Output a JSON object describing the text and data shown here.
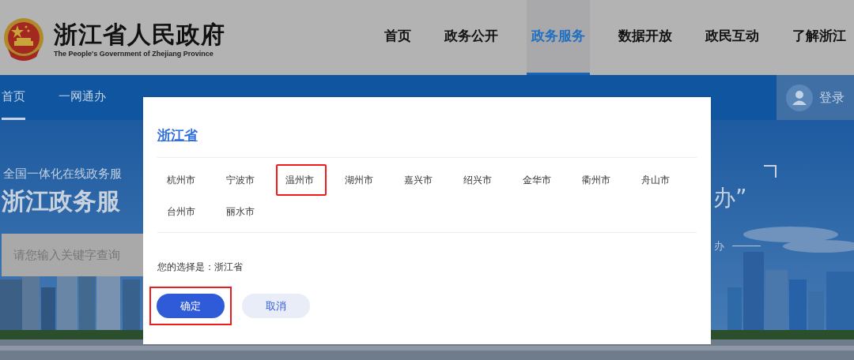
{
  "header": {
    "logo_title": "浙江省人民政府",
    "logo_subtitle": "The People's Government of Zhejiang Province",
    "nav": [
      {
        "label": "首页",
        "selected": false
      },
      {
        "label": "政务公开",
        "selected": false
      },
      {
        "label": "政务服务",
        "selected": true
      },
      {
        "label": "数据开放",
        "selected": false
      },
      {
        "label": "政民互动",
        "selected": false
      },
      {
        "label": "了解浙江",
        "selected": false
      }
    ]
  },
  "subnav": {
    "items": [
      {
        "label": "首页",
        "selected": true
      },
      {
        "label": "一网通办",
        "selected": false
      }
    ],
    "login": "登录"
  },
  "hero": {
    "kicker": "全国一体化在线政务服",
    "title": "浙江政务服",
    "slogan": "办”",
    "slogan_sub": "办",
    "search": {
      "placeholder": "请您输入关键字查询"
    }
  },
  "dialog": {
    "province": "浙江省",
    "cities": [
      {
        "name": "杭州市",
        "highlighted": false
      },
      {
        "name": "宁波市",
        "highlighted": false
      },
      {
        "name": "温州市",
        "highlighted": true
      },
      {
        "name": "湖州市",
        "highlighted": false
      },
      {
        "name": "嘉兴市",
        "highlighted": false
      },
      {
        "name": "绍兴市",
        "highlighted": false
      },
      {
        "name": "金华市",
        "highlighted": false
      },
      {
        "name": "衢州市",
        "highlighted": false
      },
      {
        "name": "舟山市",
        "highlighted": false
      },
      {
        "name": "台州市",
        "highlighted": false
      },
      {
        "name": "丽水市",
        "highlighted": false
      }
    ],
    "selection": "您的选择是：浙江省",
    "buttons": [
      {
        "label": "确定",
        "kind": "primary",
        "highlighted": true
      },
      {
        "label": "取消",
        "kind": "secondary",
        "highlighted": false
      }
    ]
  }
}
